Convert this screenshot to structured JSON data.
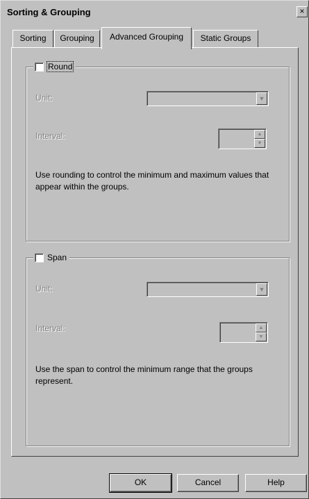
{
  "window": {
    "title": "Sorting & Grouping",
    "close_label": "×"
  },
  "tabs": [
    {
      "label": "Sorting"
    },
    {
      "label": "Grouping"
    },
    {
      "label": "Advanced Grouping",
      "active": true
    },
    {
      "label": "Static Groups"
    }
  ],
  "round": {
    "checkbox_label": "Round",
    "checked": false,
    "unit_label": "Unit:",
    "unit_value": "",
    "interval_label": "Interval:",
    "interval_value": "",
    "description": "Use rounding to control the minimum and maximum values that appear within the groups."
  },
  "span": {
    "checkbox_label": "Span",
    "checked": false,
    "unit_label": "Unit:",
    "unit_value": "",
    "interval_label": "Interval:",
    "interval_value": "",
    "description": "Use the span to control the minimum range that the groups represent."
  },
  "buttons": {
    "ok": "OK",
    "cancel": "Cancel",
    "help": "Help"
  }
}
